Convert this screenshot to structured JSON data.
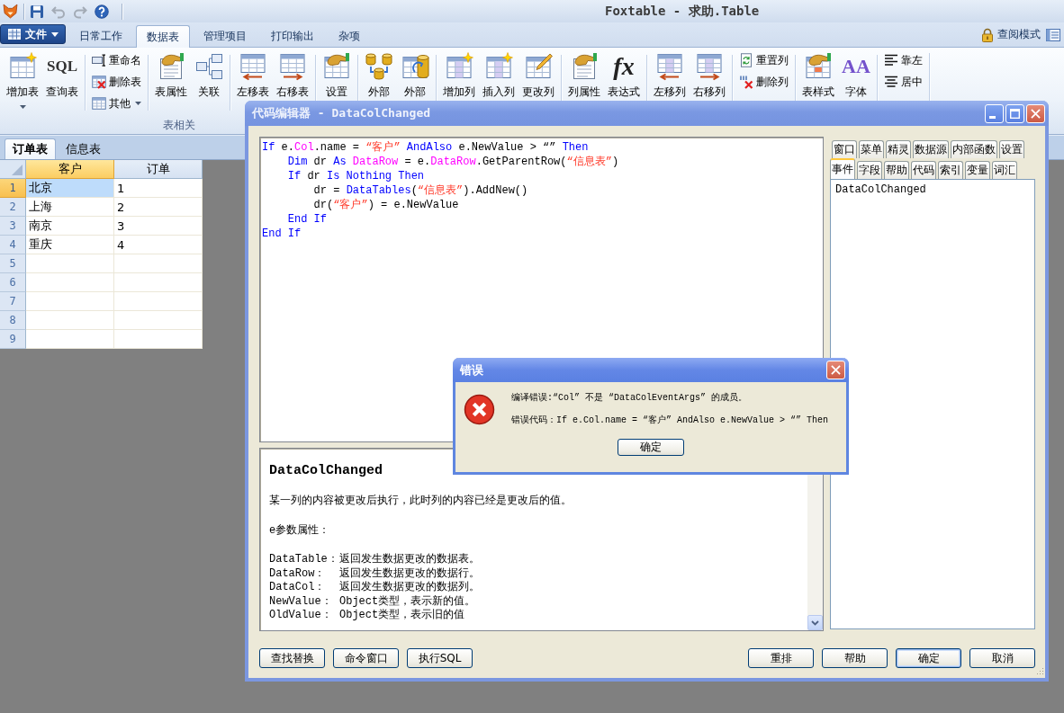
{
  "titlebar": {
    "quick_access": [
      {
        "kind": "save",
        "disabled": false
      },
      {
        "kind": "undo",
        "disabled": true
      },
      {
        "kind": "redo",
        "disabled": true
      },
      {
        "kind": "help",
        "disabled": false
      }
    ],
    "title": "Foxtable - 求助.Table"
  },
  "ribbon": {
    "file_button": "文件",
    "tabs": [
      {
        "label": "日常工作",
        "selected": false
      },
      {
        "label": "数据表",
        "selected": true
      },
      {
        "label": "管理项目",
        "selected": false
      },
      {
        "label": "打印输出",
        "selected": false
      },
      {
        "label": "杂项",
        "selected": false
      }
    ],
    "read_mode": "查阅模式",
    "groups": [
      {
        "label": "表相关",
        "sections": [
          {
            "kind": "large",
            "buttons": [
              {
                "label": "增加表",
                "dropdown": true
              },
              {
                "label": "查询表",
                "glyph": "SQL",
                "dropdown": false
              }
            ]
          },
          {
            "kind": "small",
            "buttons": [
              {
                "label": "重命名",
                "dropdown": false
              },
              {
                "label": "删除表",
                "dropdown": false
              },
              {
                "label": "其他",
                "dropdown": true
              }
            ]
          },
          {
            "kind": "large",
            "buttons": [
              {
                "label": "表属性",
                "dropdown": false
              },
              {
                "label": "关联",
                "dropdown": false
              }
            ]
          },
          {
            "kind": "large",
            "buttons": [
              {
                "label": "左移表",
                "dropdown": false
              },
              {
                "label": "右移表",
                "dropdown": false
              }
            ]
          },
          {
            "kind": "large",
            "buttons": [
              {
                "label": "设置",
                "dropdown": false
              }
            ]
          }
        ]
      },
      {
        "sections": [
          {
            "kind": "large",
            "buttons": [
              {
                "label": "外部",
                "dropdown": false
              },
              {
                "label": "外部",
                "dropdown": false
              }
            ]
          }
        ]
      },
      {
        "sections": [
          {
            "kind": "large",
            "buttons": [
              {
                "label": "增加列",
                "dropdown": false
              },
              {
                "label": "插入列",
                "dropdown": false
              },
              {
                "label": "更改列",
                "dropdown": false
              }
            ]
          }
        ]
      },
      {
        "sections": [
          {
            "kind": "large",
            "buttons": [
              {
                "label": "列属性",
                "dropdown": false
              },
              {
                "label": "表达式",
                "glyph": "fx",
                "dropdown": false
              }
            ]
          },
          {
            "kind": "large",
            "buttons": [
              {
                "label": "左移列",
                "dropdown": false
              },
              {
                "label": "右移列",
                "dropdown": false
              }
            ]
          },
          {
            "kind": "small",
            "buttons": [
              {
                "label": "重置列",
                "dropdown": false
              },
              {
                "label": "删除列",
                "dropdown": false
              }
            ]
          }
        ]
      },
      {
        "sections": [
          {
            "kind": "large",
            "buttons": [
              {
                "label": "表样式",
                "dropdown": false
              },
              {
                "label": "字体",
                "glyph": "AA",
                "dropdown": false
              }
            ]
          }
        ]
      },
      {
        "sections": [
          {
            "kind": "small",
            "buttons": [
              {
                "label": "靠左",
                "dropdown": false
              },
              {
                "label": "居中",
                "dropdown": false
              }
            ]
          }
        ]
      }
    ]
  },
  "workspace": {
    "sheet_tabs": [
      {
        "label": "订单表",
        "selected": true
      },
      {
        "label": "信息表",
        "selected": false
      }
    ],
    "table": {
      "columns": [
        {
          "label": "客户",
          "selected": true
        },
        {
          "label": "订单",
          "selected": false
        }
      ],
      "rows": [
        {
          "number": "1",
          "cells": [
            "北京",
            "1"
          ],
          "selected": true
        },
        {
          "number": "2",
          "cells": [
            "上海",
            "2"
          ],
          "selected": false
        },
        {
          "number": "3",
          "cells": [
            "南京",
            "3"
          ],
          "selected": false
        },
        {
          "number": "4",
          "cells": [
            "重庆",
            "4"
          ],
          "selected": false
        },
        {
          "number": "5",
          "selected": false
        },
        {
          "number": "6",
          "selected": false
        },
        {
          "number": "7",
          "selected": false
        },
        {
          "number": "8",
          "selected": false
        },
        {
          "number": "9",
          "selected": false
        }
      ]
    }
  },
  "code_editor": {
    "title": "代码编辑器 - DataColChanged",
    "code": [
      {
        "tokens": [
          {
            "text": "If",
            "kind": "keyword"
          },
          {
            "text": " e.",
            "kind": "plain"
          },
          {
            "text": "Col",
            "kind": "member"
          },
          {
            "text": ".name = ",
            "kind": "plain"
          },
          {
            "text": "“客户”",
            "kind": "string"
          },
          {
            "text": " AndAlso",
            "kind": "keyword"
          },
          {
            "text": " e.NewValue > “” ",
            "kind": "plain"
          },
          {
            "text": "Then",
            "kind": "keyword"
          }
        ]
      },
      {
        "tokens": [
          {
            "text": "    Dim",
            "kind": "keyword"
          },
          {
            "text": " dr ",
            "kind": "plain"
          },
          {
            "text": "As ",
            "kind": "keyword"
          },
          {
            "text": "DataRow",
            "kind": "member"
          },
          {
            "text": " = e.",
            "kind": "plain"
          },
          {
            "text": "DataRow",
            "kind": "member"
          },
          {
            "text": ".GetParentRow(",
            "kind": "plain"
          },
          {
            "text": "“信息表”",
            "kind": "string"
          },
          {
            "text": ")",
            "kind": "plain"
          }
        ]
      },
      {
        "tokens": [
          {
            "text": "    If",
            "kind": "keyword"
          },
          {
            "text": " dr ",
            "kind": "plain"
          },
          {
            "text": "Is Nothing Then",
            "kind": "keyword"
          }
        ]
      },
      {
        "tokens": [
          {
            "text": "        dr = ",
            "kind": "plain"
          },
          {
            "text": "DataTables",
            "kind": "keyword"
          },
          {
            "text": "(",
            "kind": "plain"
          },
          {
            "text": "“信息表”",
            "kind": "string"
          },
          {
            "text": ").AddNew()",
            "kind": "plain"
          }
        ]
      },
      {
        "tokens": [
          {
            "text": "        dr(",
            "kind": "plain"
          },
          {
            "text": "“客户”",
            "kind": "string"
          },
          {
            "text": ") = e.NewValue",
            "kind": "plain"
          }
        ]
      },
      {
        "tokens": [
          {
            "text": "    End If",
            "kind": "keyword"
          }
        ]
      },
      {
        "tokens": [
          {
            "text": "End If",
            "kind": "keyword"
          }
        ]
      }
    ],
    "help": {
      "title": "DataColChanged",
      "description": "某一列的内容被更改后执行，此时列的内容已经是更改后的值。",
      "section": "e参数属性：",
      "properties": [
        {
          "name": "DataTable：",
          "description": "返回发生数据更改的数据表。"
        },
        {
          "name": "DataRow：",
          "description": "返回发生数据更改的数据行。"
        },
        {
          "name": "DataCol：",
          "description": "返回发生数据更改的数据列。"
        },
        {
          "name": "NewValue：",
          "description": "Object类型，表示新的值。"
        },
        {
          "name": "OldValue：",
          "description": "Object类型，表示旧的值"
        }
      ]
    },
    "tab_rows": [
      [
        {
          "label": "窗口",
          "selected": false
        },
        {
          "label": "菜单",
          "selected": false
        },
        {
          "label": "精灵",
          "selected": false
        },
        {
          "label": "数据源",
          "selected": false
        },
        {
          "label": "内部函数",
          "selected": false
        },
        {
          "label": "设置",
          "selected": false
        }
      ],
      [
        {
          "label": "事件",
          "selected": true
        },
        {
          "label": "字段",
          "selected": false
        },
        {
          "label": "帮助",
          "selected": false
        },
        {
          "label": "代码",
          "selected": false
        },
        {
          "label": "索引",
          "selected": false
        },
        {
          "label": "变量",
          "selected": false
        },
        {
          "label": "词汇",
          "selected": false
        }
      ]
    ],
    "list_items": [
      {
        "label": "DataColChanged",
        "selected": false
      }
    ],
    "left_buttons": [
      {
        "label": "查找替换",
        "default": false
      },
      {
        "label": "命令窗口",
        "default": false
      },
      {
        "label": "执行SQL",
        "default": false
      }
    ],
    "right_buttons": [
      {
        "label": "重排",
        "default": false
      },
      {
        "label": "帮助",
        "default": false
      },
      {
        "label": "确定",
        "default": true
      },
      {
        "label": "取消",
        "default": false
      }
    ]
  },
  "error_dialog": {
    "title": "错误",
    "message": "编译错误:“Col” 不是 “DataColEventArgs” 的成员。",
    "code_line": "错误代码：If e.Col.name = “客户” AndAlso e.NewValue > “” Then",
    "button": "确定"
  }
}
